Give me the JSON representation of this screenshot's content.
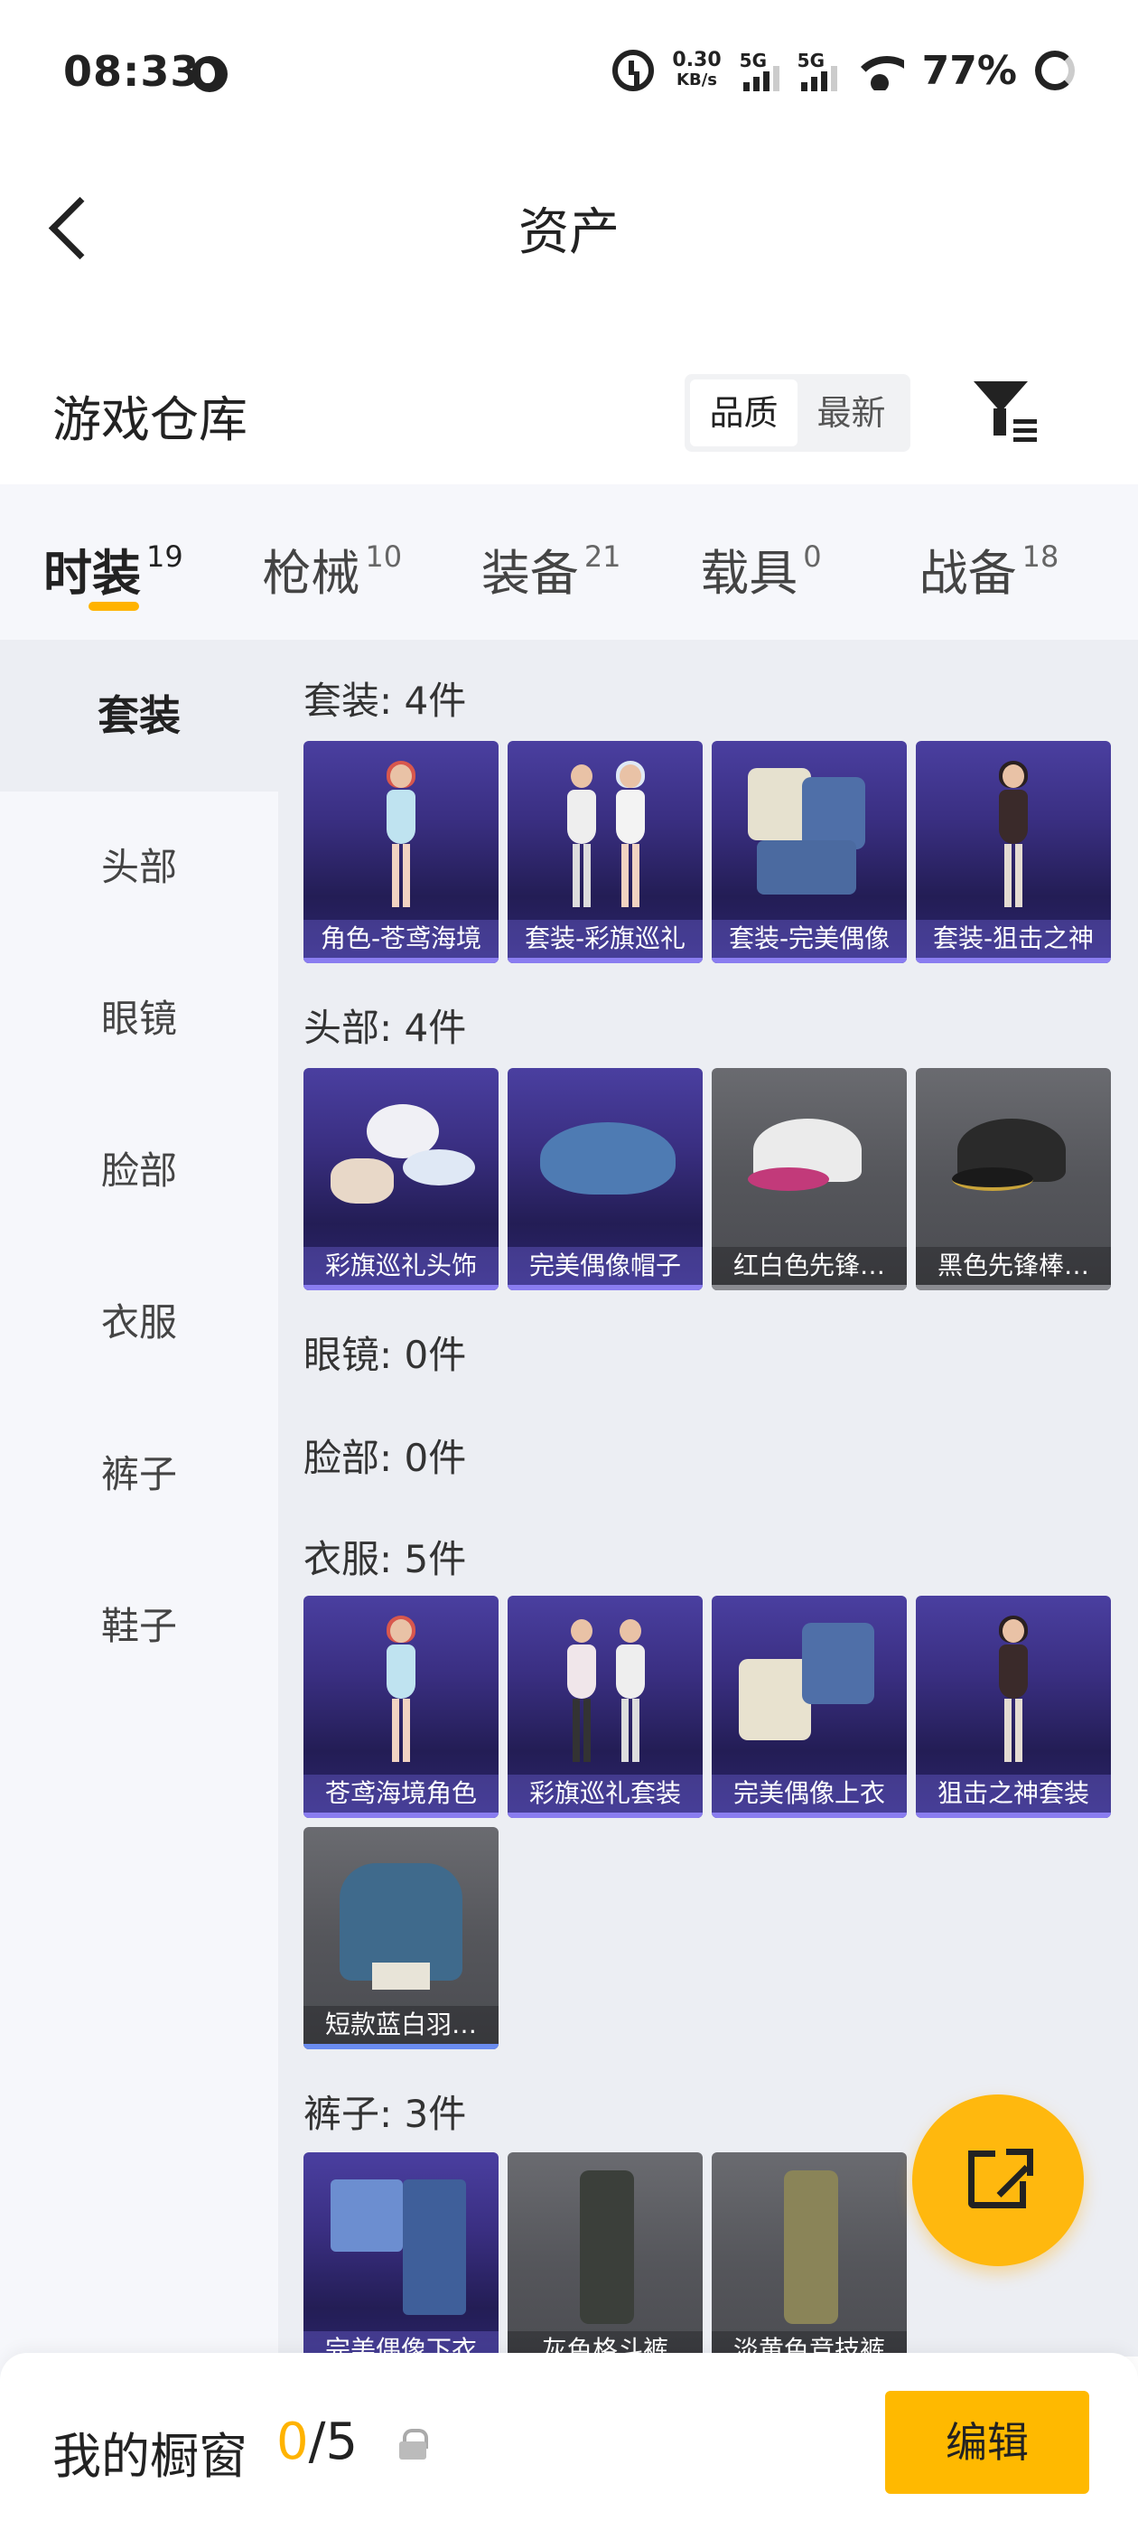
{
  "status_bar": {
    "time": "08:33",
    "net_speed_value": "0.30",
    "net_speed_unit": "KB/s",
    "signal1_label": "5G",
    "signal2_label": "5G",
    "battery": "77%"
  },
  "header": {
    "title": "资产"
  },
  "warehouse": {
    "title": "游戏仓库",
    "sort_options": [
      "品质",
      "最新"
    ],
    "active_sort": "品质"
  },
  "category_tabs": [
    {
      "label": "时装",
      "count": "19"
    },
    {
      "label": "枪械",
      "count": "10"
    },
    {
      "label": "装备",
      "count": "21"
    },
    {
      "label": "载具",
      "count": "0"
    },
    {
      "label": "战备",
      "count": "18"
    }
  ],
  "side_nav": [
    "套装",
    "头部",
    "眼镜",
    "脸部",
    "衣服",
    "裤子",
    "鞋子"
  ],
  "sections": {
    "suit": {
      "title": "套装: 4件",
      "items": [
        "角色-苍鸢海境",
        "套装-彩旗巡礼",
        "套装-完美偶像",
        "套装-狙击之神"
      ]
    },
    "head": {
      "title": "头部: 4件",
      "items": [
        "彩旗巡礼头饰",
        "完美偶像帽子",
        "红白色先锋…",
        "黑色先锋棒…"
      ]
    },
    "glasses": {
      "title": "眼镜: 0件"
    },
    "face": {
      "title": "脸部: 0件"
    },
    "clothes": {
      "title": "衣服: 5件",
      "items": [
        "苍鸢海境角色",
        "彩旗巡礼套装",
        "完美偶像上衣",
        "狙击之神套装",
        "短款蓝白羽…"
      ]
    },
    "pants": {
      "title": "裤子: 3件",
      "items": [
        "完美偶像下衣",
        "灰色格斗裤",
        "淡黄色竞技裤"
      ]
    }
  },
  "bottom_bar": {
    "title": "我的橱窗",
    "count_current": "0",
    "count_total": "/5",
    "edit_label": "编辑"
  },
  "colors": {
    "accent": "#ffb900",
    "purple_card": "#3a2f82",
    "grey_card": "#55565b"
  }
}
